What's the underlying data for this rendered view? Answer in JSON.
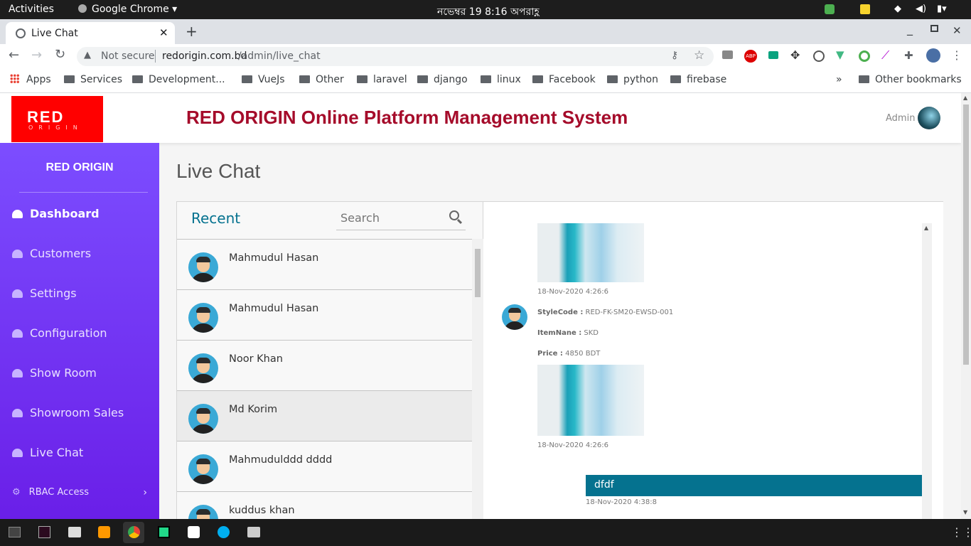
{
  "system_bar": {
    "activities": "Activities",
    "app": "Google Chrome",
    "clock": "নভেম্বর 19   8:16 অপরাহ্ণ"
  },
  "browser": {
    "tab_title": "Live Chat",
    "security": "Not secure",
    "url_host": "redorigin.com.bd",
    "url_path": "/admin/live_chat",
    "bookmarks": [
      "Apps",
      "Services",
      "Development...",
      "VueJs",
      "Other",
      "laravel",
      "django",
      "linux",
      "Facebook",
      "python",
      "firebase"
    ],
    "other_bookmarks": "Other bookmarks",
    "overflow": "»"
  },
  "header": {
    "logo_text": "RED",
    "logo_sub": "ORIGIN",
    "title": "RED ORIGIN Online Platform Management System",
    "user": "Admin"
  },
  "sidebar": {
    "brand": "RED ORIGIN",
    "items": [
      "Dashboard",
      "Customers",
      "Settings",
      "Configuration",
      "Show Room",
      "Showroom Sales",
      "Live Chat"
    ],
    "rbac": "RBAC Access"
  },
  "main": {
    "page_title": "Live Chat"
  },
  "chat_list": {
    "heading": "Recent",
    "search_placeholder": "Search",
    "contacts": [
      "Mahmudul Hasan",
      "Mahmudul Hasan",
      "Noor Khan",
      "Md Korim",
      "Mahmudulddd dddd",
      "kuddus khan"
    ]
  },
  "messages": {
    "m1_time": "18-Nov-2020 4:26:6",
    "stylecode_label": "StyleCode :",
    "stylecode_value": "RED-FK-SM20-EWSD-001",
    "itemname_label": "ItemNane :",
    "itemname_value": "SKD",
    "price_label": "Price :",
    "price_value": "4850 BDT",
    "m2_time": "18-Nov-2020 4:26:6",
    "out_text": "dfdf",
    "out_time": "18-Nov-2020 4:38:8"
  },
  "colors": {
    "brand_red": "#a50b2a",
    "accent_teal": "#05728f",
    "sidebar_purple": "#7c4dff"
  }
}
